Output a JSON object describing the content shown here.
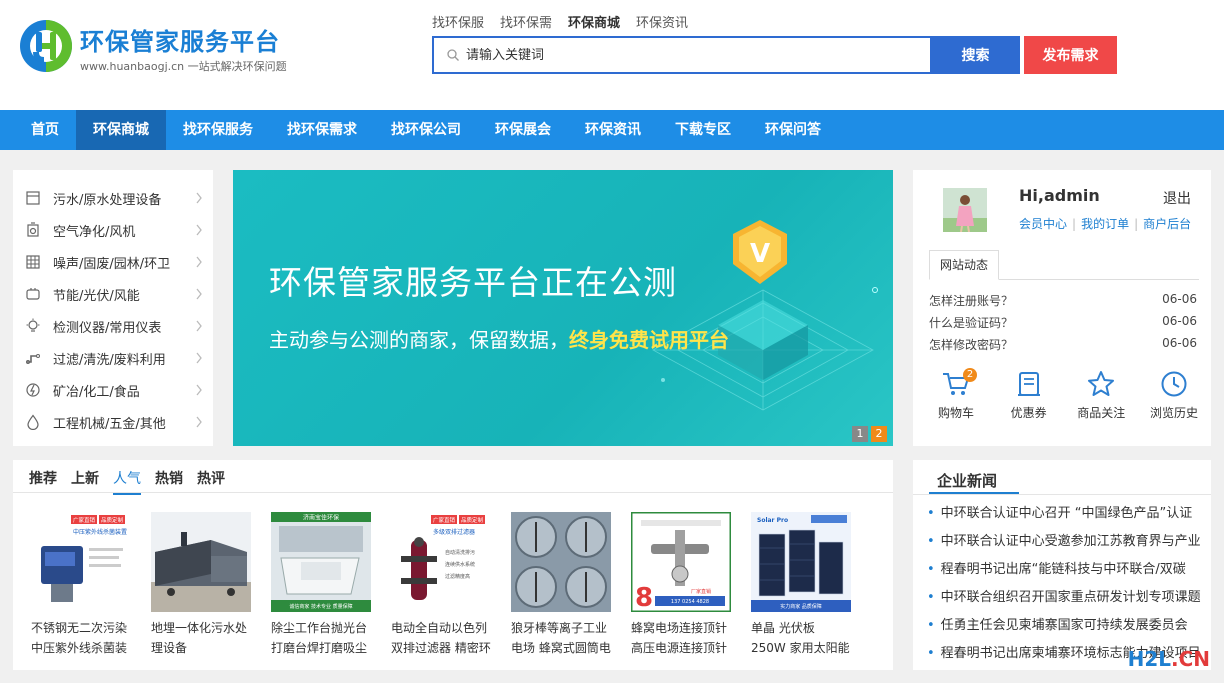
{
  "brand": {
    "title": "环保管家服务平台",
    "subtitle": "www.huanbaogj.cn  一站式解决环保问题",
    "logo_colors": [
      "#1a7fd4",
      "#5fbd2e"
    ]
  },
  "search": {
    "tabs": [
      "找环保服",
      "找环保需",
      "环保商城",
      "环保资讯"
    ],
    "active_tab": 2,
    "placeholder": "请输入关键词",
    "search_label": "搜索",
    "publish_label": "发布需求"
  },
  "nav": {
    "items": [
      "首页",
      "环保商城",
      "找环保服务",
      "找环保需求",
      "找环保公司",
      "环保展会",
      "环保资讯",
      "下载专区",
      "环保问答"
    ],
    "active": 1
  },
  "categories": [
    {
      "label": "污水/原水处理设备",
      "icon": "water-tank-icon"
    },
    {
      "label": "空气净化/风机",
      "icon": "air-purifier-icon"
    },
    {
      "label": "噪声/固废/园林/环卫",
      "icon": "grid-panel-icon"
    },
    {
      "label": "节能/光伏/风能",
      "icon": "solar-icon"
    },
    {
      "label": "检测仪器/常用仪表",
      "icon": "bulb-icon"
    },
    {
      "label": "过滤/清洗/废料利用",
      "icon": "pipe-icon"
    },
    {
      "label": "矿冶/化工/食品",
      "icon": "power-icon"
    },
    {
      "label": "工程机械/五金/其他",
      "icon": "drop-icon"
    }
  ],
  "banner": {
    "title": "环保管家服务平台正在公测",
    "sub_prefix": "主动参与公测的商家，保留数据，",
    "sub_highlight": "终身免费试用平台",
    "pages": [
      "1",
      "2"
    ],
    "active_page": 1,
    "badge_letter": "V"
  },
  "user": {
    "greeting": "Hi,admin",
    "logout": "退出",
    "links": [
      "会员中心",
      "我的订单",
      "商户后台"
    ],
    "tab": "网站动态",
    "news": [
      {
        "title": "怎样注册账号？",
        "date": "06-06"
      },
      {
        "title": "什么是验证码？",
        "date": "06-06"
      },
      {
        "title": "怎样修改密码？",
        "date": "06-06"
      }
    ],
    "tools": [
      {
        "label": "购物车",
        "icon": "cart-icon",
        "count": "2"
      },
      {
        "label": "优惠券",
        "icon": "coupon-icon"
      },
      {
        "label": "商品关注",
        "icon": "star-icon"
      },
      {
        "label": "浏览历史",
        "icon": "clock-icon"
      }
    ]
  },
  "products": {
    "tabs": [
      "推荐",
      "上新",
      "人气",
      "热销",
      "热评"
    ],
    "active_tab": 2,
    "items": [
      {
        "name": "不锈钢无二次污染中压紫外线杀菌装",
        "img": "uv-sterilizer",
        "img_text": [
          "广家直销",
          "品质定制",
          "中压紫外线杀菌装置"
        ]
      },
      {
        "name": "地埋一体化污水处理设备",
        "img": "buried-tank",
        "img_text": []
      },
      {
        "name": "除尘工作台抛光台打磨台焊打磨吸尘",
        "img": "dust-table",
        "img_text": [
          "济南宝佳环保",
          "诚信商家 技术专业 质量保障"
        ]
      },
      {
        "name": "电动全自动以色列双排过滤器 精密环",
        "img": "filter",
        "img_text": [
          "广家直销",
          "品质定制",
          "多级双排过滤器",
          "自动清洗排污",
          "连续供水系统",
          "过滤精度高"
        ]
      },
      {
        "name": "狼牙棒等离子工业电场 蜂窝式圆筒电",
        "img": "plasma",
        "img_text": []
      },
      {
        "name": "蜂窝电场连接顶针高压电源连接顶针",
        "img": "connector",
        "img_text": [
          "厂家直销",
          "137 0254 4828"
        ]
      },
      {
        "name": "单晶 光伏板 250W 家用太阳能板",
        "img": "solar-panel",
        "img_text": [
          "Solar Pro",
          "实力商家 品质保障"
        ]
      }
    ]
  },
  "corp_news": {
    "title": "企业新闻",
    "items": [
      "中环联合认证中心召开 “中国绿色产品”认证",
      "中环联合认证中心受邀参加江苏教育界与产业",
      "程春明书记出席“能链科技与中环联合/双碳",
      "中环联合组织召开国家重点研发计划专项课题",
      "任勇主任会见柬埔寨国家可持续发展委员会",
      "程春明书记出席柬埔寨环境标志能力建设项目"
    ]
  },
  "watermark": {
    "brand": "H2L",
    "suffix": ".CN"
  },
  "colors": {
    "primary": "#1e8de6",
    "nav_active": "#1868b3",
    "search_btn": "#2e6bd1",
    "publish_btn": "#f04848",
    "highlight": "#ffe44a",
    "accent_orange": "#f08a1a"
  }
}
